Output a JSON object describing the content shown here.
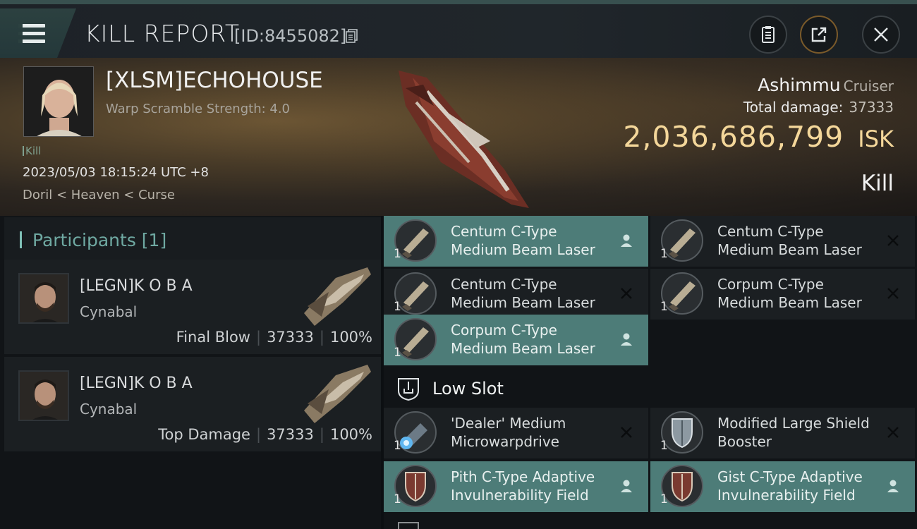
{
  "header": {
    "title": "KILL REPORT",
    "report_id": "[ID:8455082]",
    "icons": [
      "menu-icon",
      "copy-icon",
      "clipboard-icon",
      "share-icon",
      "close-icon"
    ]
  },
  "victim": {
    "name": "[XLSM]ECHOHOUSE",
    "warp_scramble": "Warp Scramble Strength: 4.0",
    "tag": "Kill",
    "datetime": "2023/05/03 18:15:24 UTC +8",
    "location": "Doril < Heaven < Curse",
    "ship": "Ashimmu",
    "ship_class": "Cruiser",
    "total_damage_label": "Total damage:",
    "total_damage": "37333",
    "isk_value": "2,036,686,799",
    "isk_unit": "ISK",
    "result": "Kill"
  },
  "participants": {
    "title": "Participants [1]",
    "rows": [
      {
        "name": "[LEGN]K O B A",
        "ship": "Cynabal",
        "role": "Final Blow",
        "damage": "37333",
        "percent": "100%"
      },
      {
        "name": "[LEGN]K O B A",
        "ship": "Cynabal",
        "role": "Top Damage",
        "damage": "37333",
        "percent": "100%"
      }
    ]
  },
  "fittings": {
    "high_modules": [
      {
        "line1": "Centum C-Type",
        "line2": "Medium Beam Laser",
        "qty": "1",
        "status": "dropped"
      },
      {
        "line1": "Centum C-Type",
        "line2": "Medium Beam Laser",
        "qty": "1",
        "status": "destroyed"
      },
      {
        "line1": "Centum C-Type",
        "line2": "Medium Beam Laser",
        "qty": "1",
        "status": "destroyed"
      },
      {
        "line1": "Corpum C-Type",
        "line2": "Medium Beam Laser",
        "qty": "1",
        "status": "destroyed"
      },
      {
        "line1": "Corpum C-Type",
        "line2": "Medium Beam Laser",
        "qty": "1",
        "status": "dropped"
      }
    ],
    "low_slot_title": "Low Slot",
    "low_modules": [
      {
        "line1": "'Dealer' Medium",
        "line2": "Microwarpdrive",
        "qty": "1",
        "status": "destroyed"
      },
      {
        "line1": "Modified Large Shield",
        "line2": "Booster",
        "qty": "1",
        "status": "destroyed"
      },
      {
        "line1": "Pith C-Type Adaptive",
        "line2": "Invulnerability Field",
        "qty": "1",
        "status": "dropped"
      },
      {
        "line1": "Gist C-Type Adaptive",
        "line2": "Invulnerability Field",
        "qty": "1",
        "status": "dropped"
      }
    ]
  },
  "colors": {
    "accent_teal": "#4d7c78",
    "isk_gold": "#f4d79a",
    "participants_title": "#6fa9a2"
  }
}
